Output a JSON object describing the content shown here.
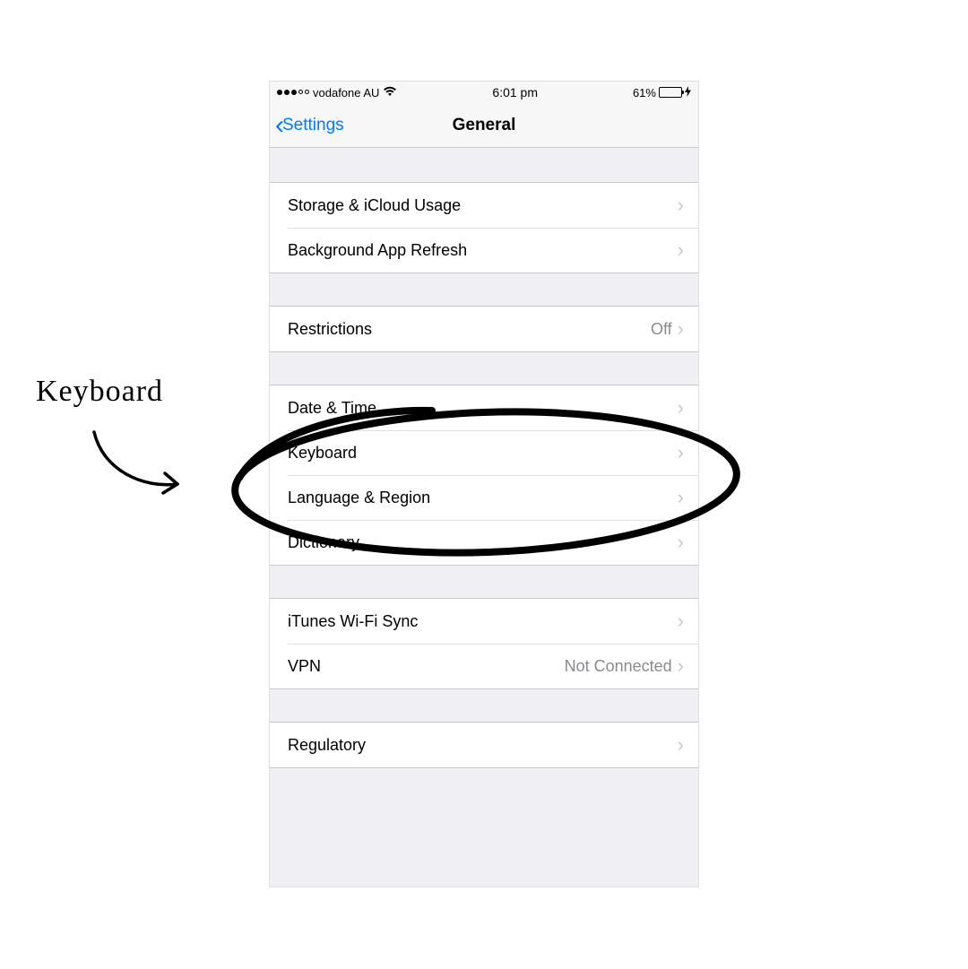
{
  "status": {
    "carrier": "vodafone AU",
    "time": "6:01 pm",
    "battery_pct": "61%",
    "battery_fill": 61
  },
  "nav": {
    "back_label": "Settings",
    "title": "General"
  },
  "groups": {
    "g1": [
      {
        "label": "Storage & iCloud Usage",
        "value": ""
      },
      {
        "label": "Background App Refresh",
        "value": ""
      }
    ],
    "g2": [
      {
        "label": "Restrictions",
        "value": "Off"
      }
    ],
    "g3": [
      {
        "label": "Date & Time",
        "value": ""
      },
      {
        "label": "Keyboard",
        "value": ""
      },
      {
        "label": "Language & Region",
        "value": ""
      },
      {
        "label": "Dictionary",
        "value": ""
      }
    ],
    "g4": [
      {
        "label": "iTunes Wi-Fi Sync",
        "value": ""
      },
      {
        "label": "VPN",
        "value": "Not Connected"
      }
    ],
    "g5": [
      {
        "label": "Regulatory",
        "value": ""
      }
    ]
  },
  "annotation": {
    "text": "Keyboard"
  }
}
